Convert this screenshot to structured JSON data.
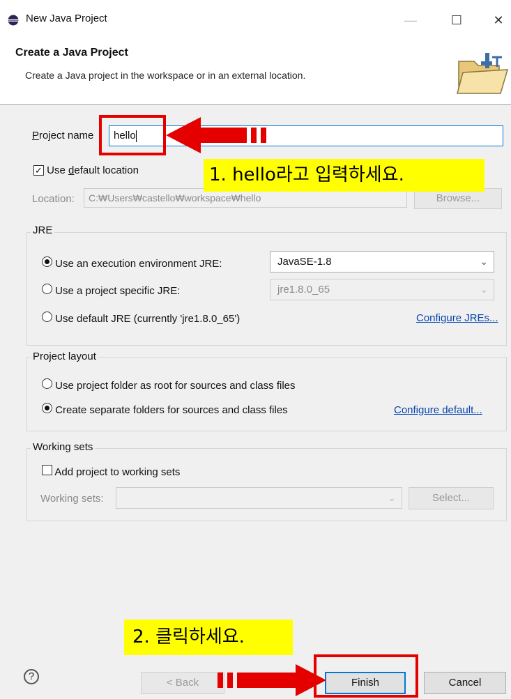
{
  "window": {
    "title": "New Java Project",
    "minimize_glyph": "—",
    "maximize_glyph": "☐",
    "close_glyph": "✕"
  },
  "header": {
    "title": "Create a Java Project",
    "description": "Create a Java project in the workspace or in an external location."
  },
  "project_name": {
    "label_first": "P",
    "label_rest": "roject name",
    "value": "hello"
  },
  "use_default_location": {
    "checked": true,
    "label_pre": "Use ",
    "label_u": "d",
    "label_post": "efault location"
  },
  "location": {
    "label": "Location:",
    "value": "C:₩Users₩castello₩workspace₩hello",
    "browse_label": "Browse..."
  },
  "jre": {
    "group_title": "JRE",
    "option_execution_env": "Use an execution environment JRE:",
    "option_specific": "Use a project specific JRE:",
    "option_default": "Use default JRE (currently 'jre1.8.0_65')",
    "execution_env_value": "JavaSE-1.8",
    "specific_value": "jre1.8.0_65",
    "configure_link": "Configure JREs...",
    "selected": "execution_env"
  },
  "project_layout": {
    "group_title": "Project layout",
    "option_root": "Use project folder as root for sources and class files",
    "option_separate": "Create separate folders for sources and class files",
    "configure_link": "Configure default...",
    "selected": "separate"
  },
  "working_sets": {
    "group_title": "Working sets",
    "add_label": "Add project to working sets",
    "add_checked": false,
    "field_label": "Working sets:",
    "select_label": "Select..."
  },
  "footer": {
    "help_glyph": "?",
    "back_label": "< Back",
    "finish_label": "Finish",
    "cancel_label": "Cancel"
  },
  "annotations": {
    "callout_1": "1. hello라고 입력하세요.",
    "callout_2": "2. 클릭하세요.",
    "accent_red": "#e50000",
    "highlight_yellow": "#ffff00"
  }
}
